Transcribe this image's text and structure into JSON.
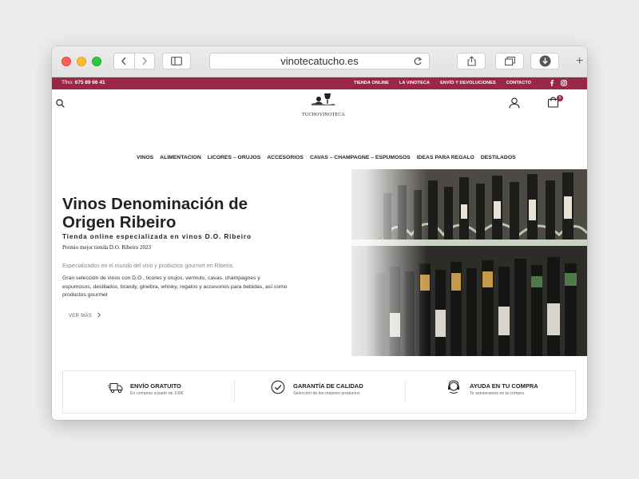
{
  "browser": {
    "url": "vinotecatucho.es"
  },
  "topbar": {
    "phone_label": "Tfno:",
    "phone_number": "675 89 66 41",
    "links": [
      "TIENDA ONLINE",
      "LA VINOTECA",
      "ENVÍO Y DEVOLUCIONES",
      "CONTACTO"
    ]
  },
  "header": {
    "logo_text": "TUCHOVINOTECA",
    "cart_count": "0"
  },
  "menu": [
    "VINOS",
    "ALIMENTACION",
    "LICORES – ORUJOS",
    "ACCESORIOS",
    "CAVAS – CHAMPAGNE – ESPUMOSOS",
    "IDEAS PARA REGALO",
    "DESTILADOS"
  ],
  "hero": {
    "title": "Vinos Denominación de Origen Ribeiro",
    "subtitle": "Tienda online especializada en vinos D.O. Ribeiro",
    "award": "Premio mejor tienda D.O. Ribeiro 2023",
    "intro": "Especializados en el mundo del vino y productos gourmet en Ribeira.",
    "description": "Gran selección de vinos con D.O., licores y orujos, vermuts, cavas, champagnes y espumosos, destilados, brandy, ginebra, whisky, regalos y accesorios para bebidas, así como productos gourmet",
    "more": "VER MÁS"
  },
  "features": [
    {
      "title": "ENVÍO GRATUITO",
      "subtitle": "En compras a partir de 100€",
      "icon": "delivery-truck-icon"
    },
    {
      "title": "GARANTÍA DE CALIDAD",
      "subtitle": "Selección de los mejores productos",
      "icon": "check-circle-icon"
    },
    {
      "title": "AYUDA EN TU COMPRA",
      "subtitle": "Te asesoramos en la compra",
      "icon": "support-headset-icon"
    }
  ],
  "colors": {
    "brand": "#9b2748",
    "text": "#222222"
  }
}
